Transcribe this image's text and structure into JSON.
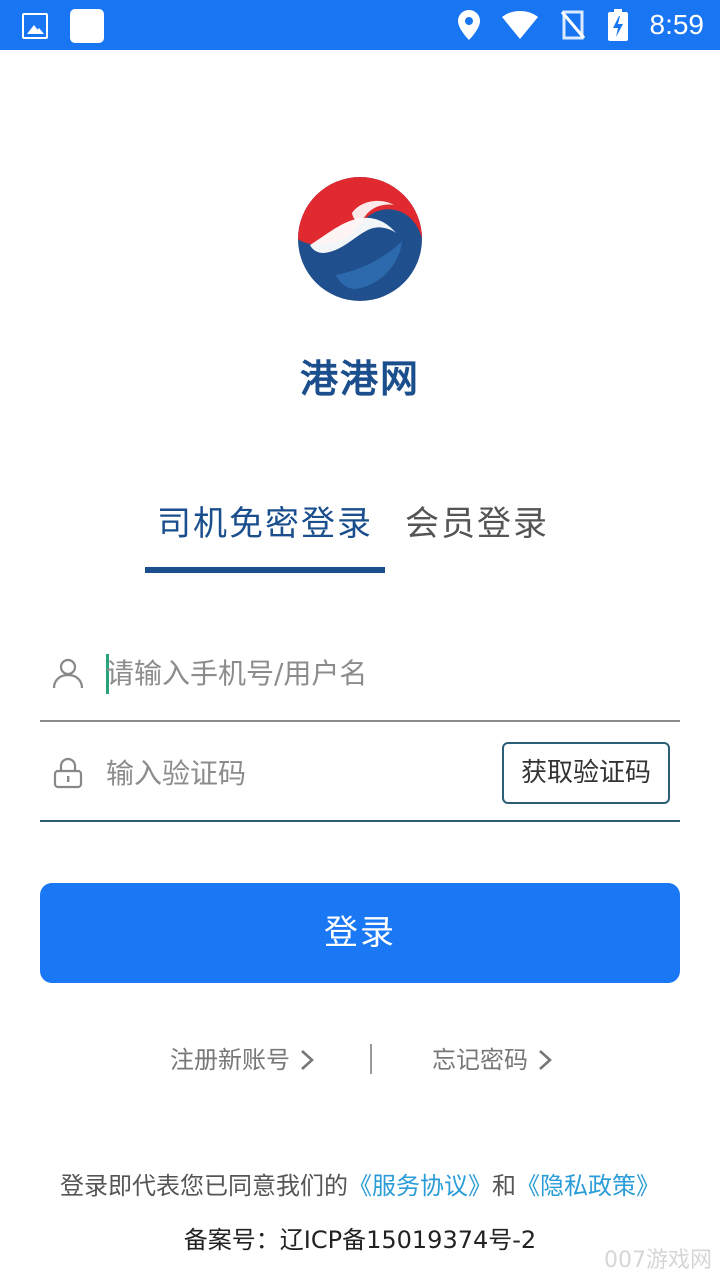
{
  "status_bar": {
    "time": "8:59",
    "left_icons": [
      "gallery-icon",
      "notification-icon"
    ],
    "right_icons": [
      "location-icon",
      "wifi-icon",
      "no-signal-icon",
      "battery-charging-icon"
    ]
  },
  "app": {
    "name": "港港网",
    "logo": "taiji-logo"
  },
  "tabs": {
    "active": "司机免密登录",
    "inactive": "会员登录"
  },
  "form": {
    "phone_placeholder": "请输入手机号/用户名",
    "code_placeholder": "输入验证码",
    "get_code_label": "获取验证码",
    "login_label": "登录"
  },
  "links": {
    "register": "注册新账号",
    "forgot": "忘记密码"
  },
  "agreement": {
    "prefix": "登录即代表您已同意我们的",
    "service": "《服务协议》",
    "and": "和",
    "privacy": "《隐私政策》"
  },
  "icp": "备案号：辽ICP备15019374号-2",
  "watermark": "007游戏网",
  "colors": {
    "status_bar": "#1976f2",
    "primary": "#1a78f5",
    "brand": "#1a4e8c",
    "link": "#2a9cd8"
  }
}
